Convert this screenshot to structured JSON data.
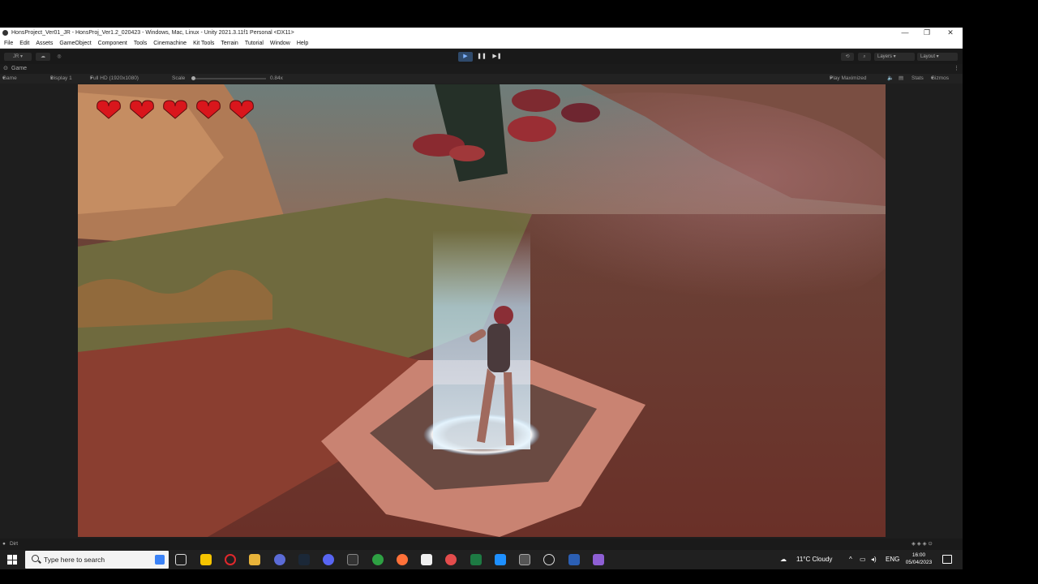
{
  "window": {
    "title": "HonsProject_Ver01_JR - HonsProj_Ver1.2_020423 - Windows, Mac, Linux - Unity 2021.3.11f1 Personal <DX11>",
    "minimize": "—",
    "maximize": "❐",
    "close": "✕"
  },
  "menu": [
    "File",
    "Edit",
    "Assets",
    "GameObject",
    "Component",
    "Tools",
    "Cinemachine",
    "Kit Tools",
    "Terrain",
    "Tutorial",
    "Window",
    "Help"
  ],
  "toolbar": {
    "account": "JR ▾",
    "play": "▶",
    "pause": "❚❚",
    "step": "▶❚",
    "layers": "Layers",
    "layout": "Layout"
  },
  "game_tab": {
    "label": "Game",
    "mode": "Game",
    "display": "Display 1",
    "resolution": "Full HD (1920x1080)",
    "scale_label": "Scale",
    "scale_value": "0.84x",
    "play_maximized": "Play Maximized",
    "stats": "Stats",
    "gizmos": "Gizmos"
  },
  "hud": {
    "hearts": 5,
    "heart_color": "#d9161c"
  },
  "status": {
    "text": "Dirt"
  },
  "taskbar": {
    "search_placeholder": "Type here to search",
    "weather": "11°C  Cloudy",
    "language": "ENG",
    "time": "16:00",
    "date": "05/04/2023"
  },
  "colors": {
    "play_active": "#2f4a6b",
    "portal": "#bfe6ff"
  }
}
